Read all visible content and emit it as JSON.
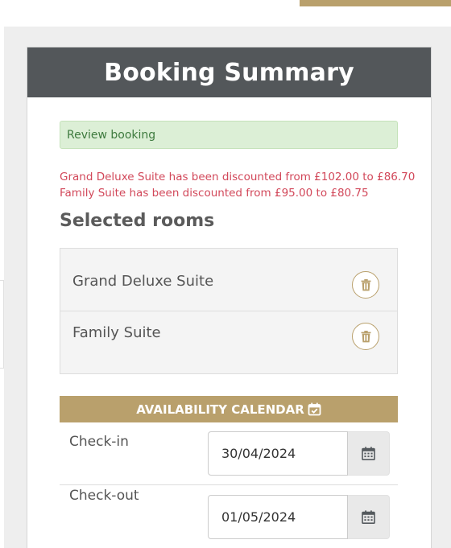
{
  "panel": {
    "title": "Booking Summary"
  },
  "alert": {
    "text": "Review booking"
  },
  "discounts": [
    "Grand Deluxe Suite has been discounted from £102.00 to £86.70",
    "Family Suite has been discounted from £95.00 to £80.75"
  ],
  "selected_rooms": {
    "heading": "Selected rooms",
    "rooms": [
      {
        "name": "Grand Deluxe Suite"
      },
      {
        "name": "Family Suite"
      }
    ]
  },
  "calendar": {
    "label": "AVAILABILITY CALENDAR",
    "icon": "calendar-check-icon",
    "checkin": {
      "label": "Check-in",
      "value": "30/04/2024"
    },
    "checkout": {
      "label": "Check-out",
      "value": "01/05/2024"
    }
  },
  "colors": {
    "header": "#53575a",
    "accent": "#b9a06c",
    "discount_text": "#d2485a",
    "alert_bg": "#dcefd6"
  }
}
